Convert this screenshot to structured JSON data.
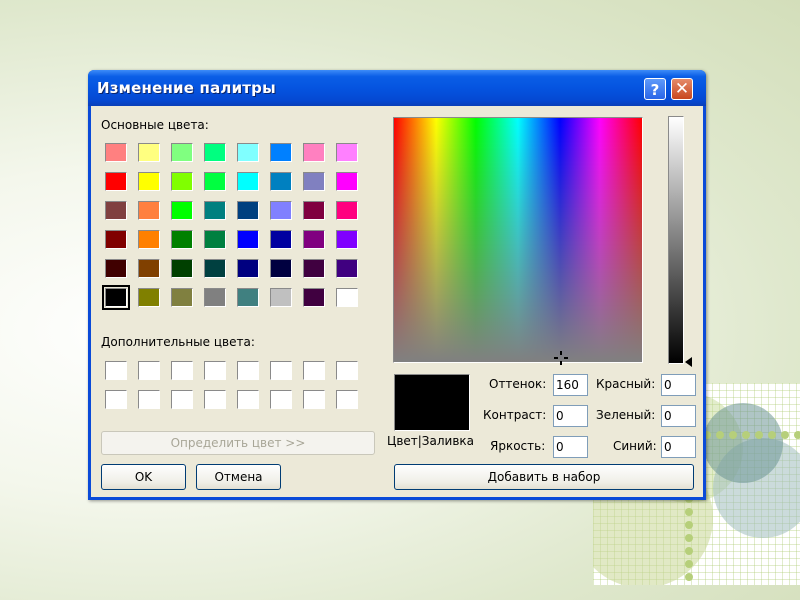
{
  "dialog": {
    "title": "Изменение палитры",
    "help_button": "?",
    "close_button": "✕"
  },
  "basic_colors_label": "Основные цвета:",
  "basic_colors": [
    [
      "#ff8080",
      "#ffff80",
      "#80ff80",
      "#00ff80",
      "#80ffff",
      "#0080ff",
      "#ff80c0",
      "#ff80ff"
    ],
    [
      "#ff0000",
      "#ffff00",
      "#80ff00",
      "#00ff40",
      "#00ffff",
      "#0080c0",
      "#8080c0",
      "#ff00ff"
    ],
    [
      "#804040",
      "#ff8040",
      "#00ff00",
      "#008080",
      "#004080",
      "#8080ff",
      "#800040",
      "#ff0080"
    ],
    [
      "#800000",
      "#ff8000",
      "#008000",
      "#008040",
      "#0000ff",
      "#0000a0",
      "#800080",
      "#8000ff"
    ],
    [
      "#400000",
      "#804000",
      "#004000",
      "#004040",
      "#000080",
      "#000040",
      "#400040",
      "#400080"
    ],
    [
      "#000000",
      "#808000",
      "#808040",
      "#808080",
      "#408080",
      "#c0c0c0",
      "#400040",
      "#ffffff"
    ]
  ],
  "selected_basic_color": "#000000",
  "custom_colors_label": "Дополнительные цвета:",
  "custom_colors_count": 16,
  "define_button": "Определить цвет >>",
  "ok_button": "OK",
  "cancel_button": "Отмена",
  "add_button": "Добавить в набор",
  "color_solid_label": "Цвет|Заливка",
  "current_color": "#000000",
  "fields": {
    "hue": {
      "label": "Оттенок:",
      "value": "160"
    },
    "sat": {
      "label": "Контраст:",
      "value": "0"
    },
    "lum": {
      "label": "Яркость:",
      "value": "0"
    },
    "red": {
      "label": "Красный:",
      "value": "0"
    },
    "green": {
      "label": "Зеленый:",
      "value": "0"
    },
    "blue": {
      "label": "Синий:",
      "value": "0"
    }
  }
}
